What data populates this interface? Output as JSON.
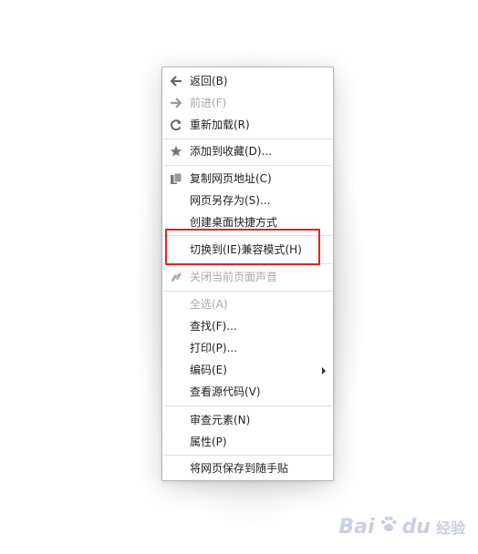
{
  "menu": {
    "items": [
      {
        "label": "返回(B)",
        "icon": "back-arrow-icon",
        "disabled": false
      },
      {
        "label": "前进(F)",
        "icon": "forward-arrow-icon",
        "disabled": true
      },
      {
        "label": "重新加载(R)",
        "icon": "reload-icon",
        "disabled": false
      },
      {
        "label": "添加到收藏(D)...",
        "icon": "star-icon",
        "disabled": false
      },
      {
        "label": "复制网页地址(C)",
        "icon": "copy-icon",
        "disabled": false
      },
      {
        "label": "网页另存为(S)...",
        "disabled": false
      },
      {
        "label": "创建桌面快捷方式",
        "disabled": false
      },
      {
        "label": "切换到(IE)兼容模式(H)",
        "disabled": false
      },
      {
        "label": "关闭当前页面声音",
        "icon": "mute-icon",
        "disabled": true
      },
      {
        "label": "全选(A)",
        "disabled": true
      },
      {
        "label": "查找(F)...",
        "disabled": false
      },
      {
        "label": "打印(P)...",
        "disabled": false
      },
      {
        "label": "编码(E)",
        "disabled": false,
        "submenu": true
      },
      {
        "label": "查看源代码(V)",
        "disabled": false
      },
      {
        "label": "审查元素(N)",
        "disabled": false
      },
      {
        "label": "属性(P)",
        "disabled": false
      },
      {
        "label": "将网页保存到随手贴",
        "disabled": false
      }
    ]
  },
  "watermark": {
    "left": "Bai",
    "right": "du",
    "sub": "经验"
  },
  "colors": {
    "highlight": "#e02424",
    "text": "#222222",
    "disabled": "#a8a8a8"
  }
}
